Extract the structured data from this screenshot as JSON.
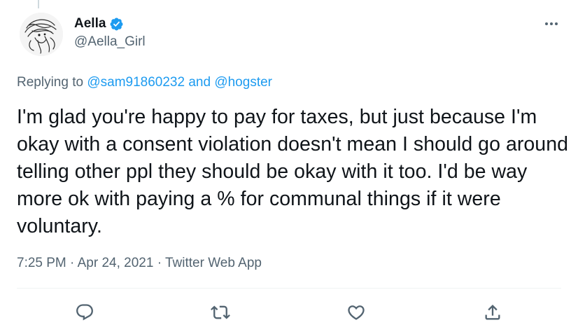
{
  "tweet": {
    "author": {
      "display_name": "Aella",
      "handle": "@Aella_Girl",
      "verified": true,
      "verified_color": "#1d9bf0"
    },
    "replying_prefix": "Replying to",
    "replying_to": [
      "@sam91860232",
      "@hogster"
    ],
    "replying_joiner": "and",
    "text": "I'm glad you're happy to pay for taxes, but just because I'm okay with a consent violation doesn't mean I should go around telling other ppl they should be okay with it too. I'd be way more ok with paying a % for communal things if it were voluntary.",
    "time": "7:25 PM",
    "date": "Apr 24, 2021",
    "source": "Twitter Web App",
    "separator": "·"
  },
  "actions": [
    {
      "name": "reply",
      "icon": "reply-icon"
    },
    {
      "name": "retweet",
      "icon": "retweet-icon"
    },
    {
      "name": "like",
      "icon": "heart-icon"
    },
    {
      "name": "share",
      "icon": "share-icon"
    }
  ],
  "colors": {
    "text": "#0f1419",
    "secondary": "#536471",
    "link": "#1d9bf0",
    "divider": "#eff3f4"
  }
}
